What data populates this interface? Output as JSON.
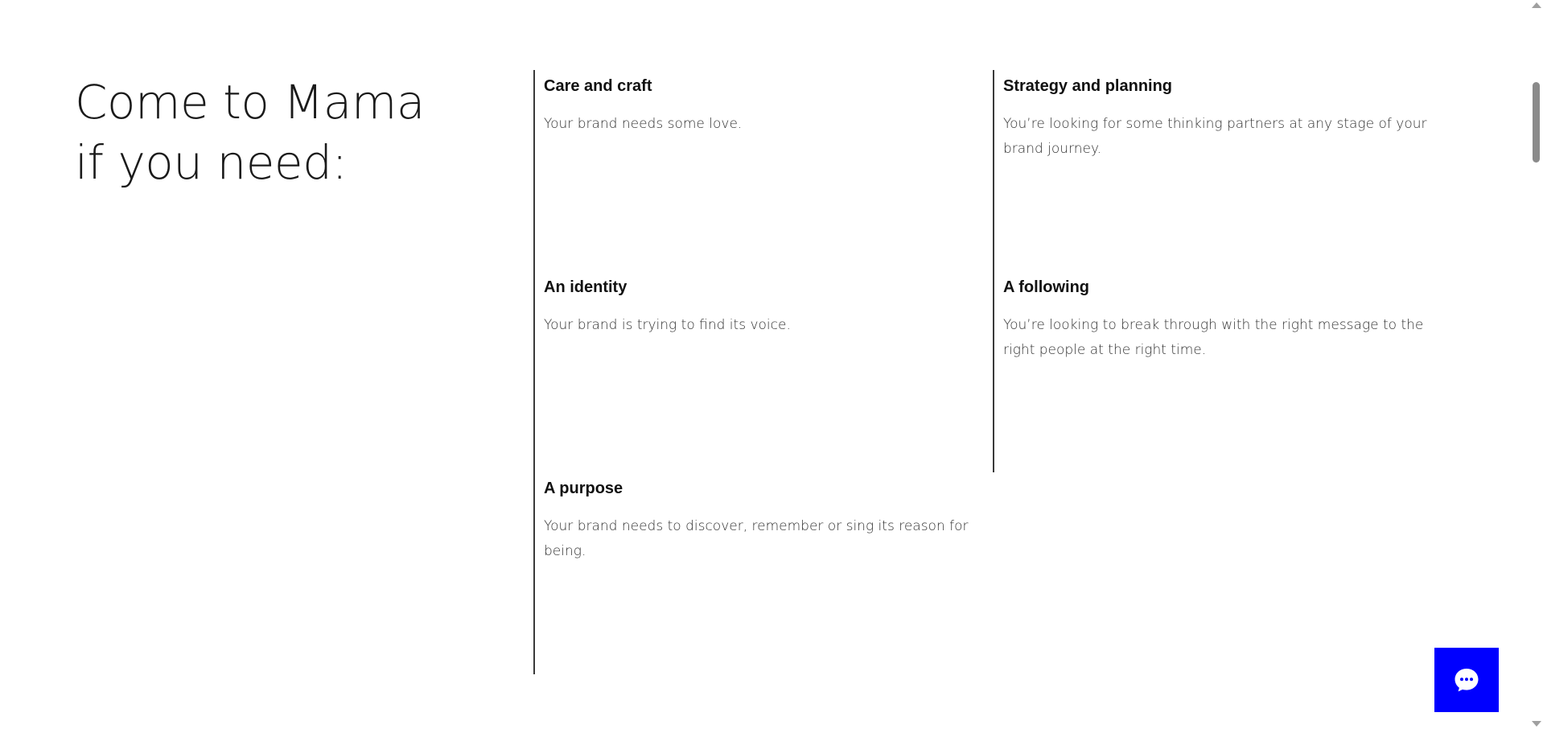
{
  "headline": {
    "line1": "Come to Mama",
    "line2": "if you need:"
  },
  "needs": [
    {
      "title": "Care and craft",
      "text": "Your brand needs some love."
    },
    {
      "title": "Strategy and planning",
      "text": "You’re looking for some thinking partners at any stage of your brand journey."
    },
    {
      "title": "An identity",
      "text": "Your brand is trying to find its voice."
    },
    {
      "title": "A following",
      "text": "You’re looking to break through with the right message to the right people at the right time."
    },
    {
      "title": "A purpose",
      "text": "Your brand needs to discover, remember or sing its reason for being."
    }
  ],
  "chat": {
    "icon": "chat-bubble-icon",
    "color": "#0000ff"
  },
  "colors": {
    "accent": "#0000ff",
    "divider": "#3a3a3a",
    "text": "#111111"
  }
}
